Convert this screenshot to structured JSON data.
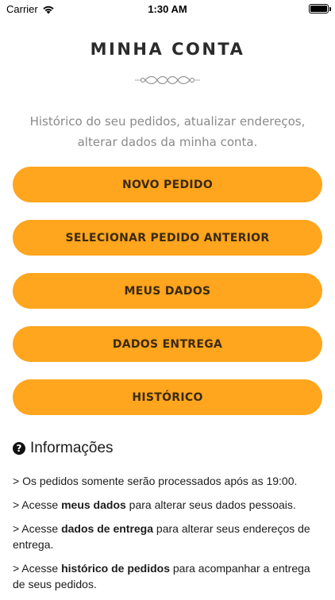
{
  "status_bar": {
    "carrier": "Carrier",
    "time": "1:30 AM"
  },
  "header": {
    "title": "MINHA CONTA"
  },
  "subtitle": "Histórico do seu pedidos, atualizar endereços, alterar dados da minha conta.",
  "menu": {
    "buttons": [
      {
        "label": "NOVO PEDIDO"
      },
      {
        "label": "SELECIONAR PEDIDO ANTERIOR"
      },
      {
        "label": "MEUS DADOS"
      },
      {
        "label": "DADOS ENTREGA"
      },
      {
        "label": "HISTÓRICO"
      }
    ]
  },
  "info": {
    "title": "Informações",
    "items": [
      {
        "prefix": "> Os pedidos somente serão processados após as 19:00.",
        "bold": "",
        "suffix": ""
      },
      {
        "prefix": "> Acesse ",
        "bold": "meus dados",
        "suffix": " para alterar seus dados pessoais."
      },
      {
        "prefix": "> Acesse ",
        "bold": "dados de entrega",
        "suffix": " para alterar seus endereços de entrega."
      },
      {
        "prefix": "> Acesse ",
        "bold": "histórico de pedidos",
        "suffix": " para acompanhar a entrega de seus pedidos."
      }
    ]
  },
  "colors": {
    "accent": "#ffa51e",
    "subtitle": "#8a8a8a"
  }
}
